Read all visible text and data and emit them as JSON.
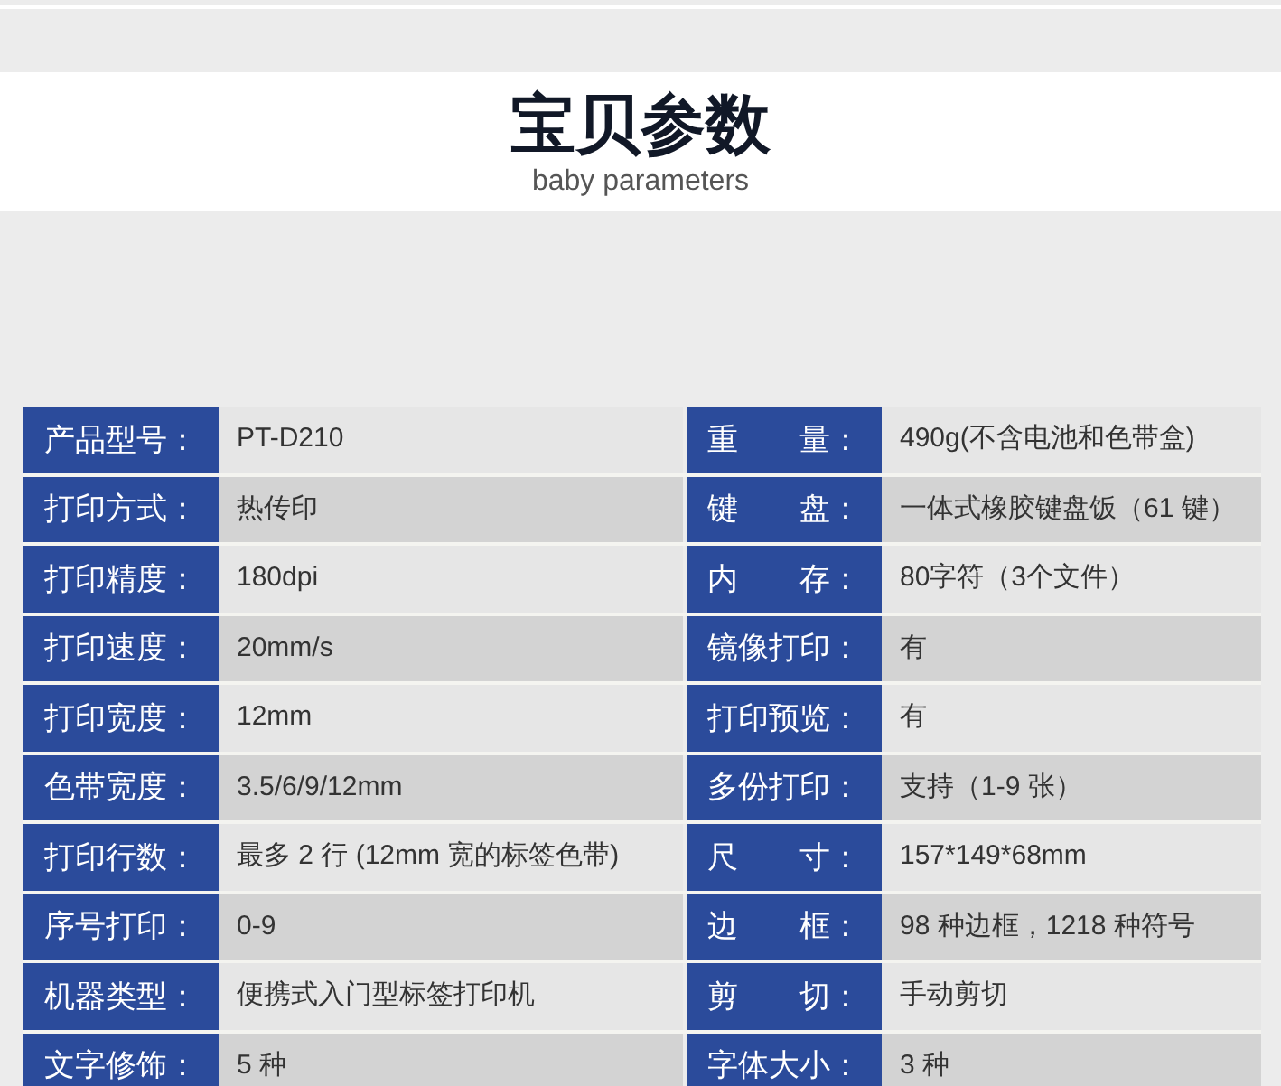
{
  "header": {
    "title": "宝贝参数",
    "subtitle": "baby parameters"
  },
  "rows": [
    {
      "cells": [
        {
          "label": "产品型号：",
          "value": "PT-D210"
        },
        {
          "label": "重　　量：",
          "value": "490g(不含电池和色带盒)"
        }
      ]
    },
    {
      "cells": [
        {
          "label": "打印方式：",
          "value": "热传印"
        },
        {
          "label": "键　　盘：",
          "value": "一体式橡胶键盘饭（61 键）"
        }
      ]
    },
    {
      "cells": [
        {
          "label": "打印精度：",
          "value": "180dpi"
        },
        {
          "label": "内　　存：",
          "value": "80字符（3个文件）"
        }
      ]
    },
    {
      "cells": [
        {
          "label": "打印速度：",
          "value": "20mm/s"
        },
        {
          "label": "镜像打印：",
          "value": "有"
        }
      ]
    },
    {
      "cells": [
        {
          "label": "打印宽度：",
          "value": "12mm"
        },
        {
          "label": "打印预览：",
          "value": "有"
        }
      ]
    },
    {
      "cells": [
        {
          "label": "色带宽度：",
          "value": "3.5/6/9/12mm"
        },
        {
          "label": "多份打印：",
          "value": "支持（1-9 张）"
        }
      ]
    },
    {
      "cells": [
        {
          "label": "打印行数：",
          "value": "最多 2 行 (12mm 宽的标签色带)"
        },
        {
          "label": "尺　　寸：",
          "value": "157*149*68mm"
        }
      ]
    },
    {
      "cells": [
        {
          "label": "序号打印：",
          "value": "0-9"
        },
        {
          "label": "边　　框：",
          "value": "98 种边框，1218 种符号"
        }
      ]
    },
    {
      "cells": [
        {
          "label": "机器类型：",
          "value": "便携式入门型标签打印机"
        },
        {
          "label": "剪　　切：",
          "value": "手动剪切"
        }
      ]
    },
    {
      "cells": [
        {
          "label": "文字修饰：",
          "value": "5 种"
        },
        {
          "label": "字体大小：",
          "value": "3 种"
        }
      ]
    }
  ]
}
